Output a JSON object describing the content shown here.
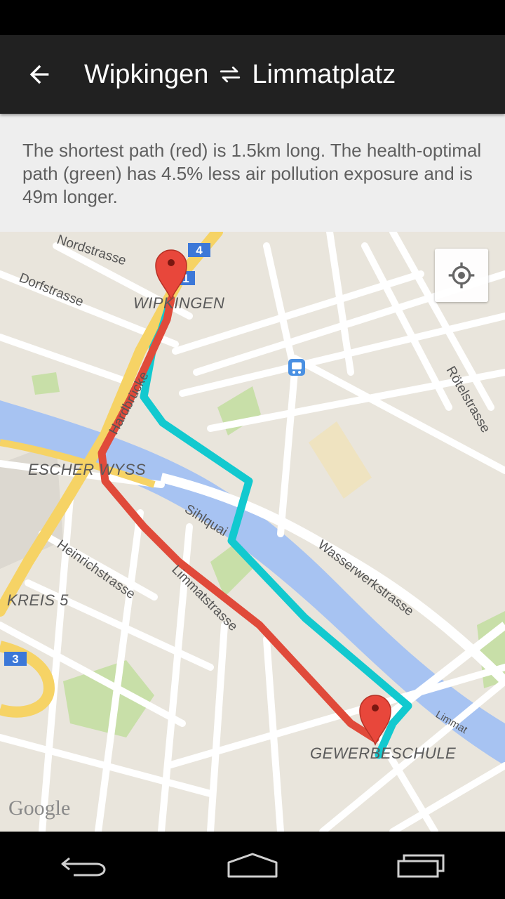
{
  "app_bar": {
    "origin": "Wipkingen",
    "destination": "Limmatplatz",
    "back_icon": "arrow-left-icon",
    "swap_icon": "swap-arrows-icon"
  },
  "info": {
    "text": "The shortest path (red) is 1.5km long. The health-optimal path (green) has 4.5% less air pollution exposure and is 49m longer."
  },
  "map": {
    "streets": {
      "nordstrasse": "Nordstrasse",
      "dorfstrasse": "Dorfstrasse",
      "hardbruecke": "Hardbrücke",
      "sihlquai": "Sihlquai",
      "limmatstrasse": "Limmatstrasse",
      "heinrichstrasse": "Heinrichstrasse",
      "wasserwerkstrasse": "Wasserwerkstrasse",
      "roetelstrasse": "Rötelstrasse",
      "limmat": "Limmat"
    },
    "places": {
      "wipkingen": "WIPKINGEN",
      "escher_wyss": "ESCHER WYSS",
      "kreis5": "KREIS 5",
      "gewerbeschule": "GEWERBESCHULE"
    },
    "road_badges": {
      "four": "4",
      "one": "1",
      "three": "3"
    },
    "attribution": "Google",
    "colors": {
      "shortest_path": "#e04a3a",
      "healthy_path": "#12c9cf",
      "river": "#a7c3f2",
      "highway": "#f6d365"
    }
  },
  "nav": {
    "back": "nav-back-icon",
    "home": "nav-home-icon",
    "recents": "nav-recents-icon"
  }
}
